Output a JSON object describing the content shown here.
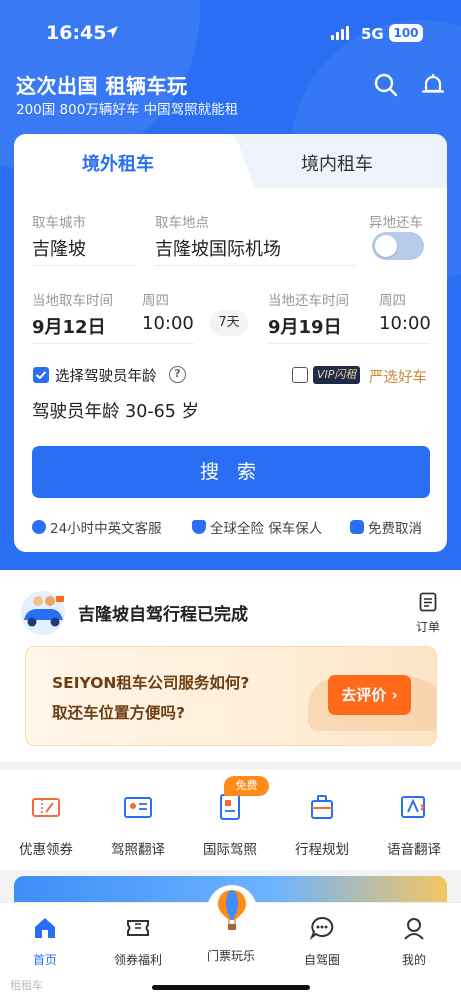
{
  "status_bar": {
    "time": "16:45",
    "network": "5G",
    "battery": "100"
  },
  "header": {
    "title": "这次出国 租辆车玩",
    "subtitle": "200国 800万辆好车 中国驾照就能租"
  },
  "booking": {
    "tabs": [
      {
        "label": "境外租车",
        "active": true
      },
      {
        "label": "境内租车",
        "active": false
      }
    ],
    "pickup_city_label": "取车城市",
    "pickup_city": "吉隆坡",
    "pickup_location_label": "取车地点",
    "pickup_location": "吉隆坡国际机场",
    "diff_return_label": "异地还车",
    "diff_return_on": false,
    "pickup_time_label": "当地取车时间",
    "pickup_weekday": "周四",
    "pickup_date": "9月12日",
    "pickup_time": "10:00",
    "duration": "7天",
    "return_time_label": "当地还车时间",
    "return_weekday": "周四",
    "return_date": "9月19日",
    "return_time": "10:00",
    "driver_age_checkbox": "选择驾驶员年龄",
    "driver_age_checked": true,
    "vip_badge": "VIP闪租",
    "premium_label": "严选好车",
    "premium_checked": false,
    "driver_age_text": "驾驶员年龄 30-65 岁",
    "search_button": "搜 索",
    "guarantees": [
      "24小时中英文客服",
      "全球全险 保车保人",
      "免费取消"
    ]
  },
  "trip": {
    "title": "吉隆坡自驾行程已完成",
    "order_label": "订单",
    "review_line1": "SEIYON租车公司服务如何?",
    "review_line2": "取还车位置方便吗?",
    "review_button": "去评价 ›"
  },
  "shortcuts": {
    "items": [
      {
        "label": "优惠领券",
        "icon": "coupon-icon"
      },
      {
        "label": "驾照翻译",
        "icon": "license-icon"
      },
      {
        "label": "国际驾照",
        "icon": "intl-license-icon"
      },
      {
        "label": "行程规划",
        "icon": "luggage-icon"
      },
      {
        "label": "语音翻译",
        "icon": "voice-translate-icon"
      }
    ],
    "free_badge": "免费"
  },
  "bottom_nav": {
    "items": [
      {
        "label": "首页",
        "icon": "home-icon",
        "active": true
      },
      {
        "label": "领券福利",
        "icon": "ticket-icon",
        "active": false
      },
      {
        "label": "门票玩乐",
        "icon": "balloon-icon",
        "active": false
      },
      {
        "label": "自驾圈",
        "icon": "chat-icon",
        "active": false
      },
      {
        "label": "我的",
        "icon": "profile-icon",
        "active": false
      }
    ]
  },
  "watermark": "租租车",
  "colors": {
    "primary": "#2a6ff3",
    "accent_orange": "#ff6a1a",
    "badge_orange": "#ff8c1a",
    "vip_dark": "#1f2a4d"
  }
}
